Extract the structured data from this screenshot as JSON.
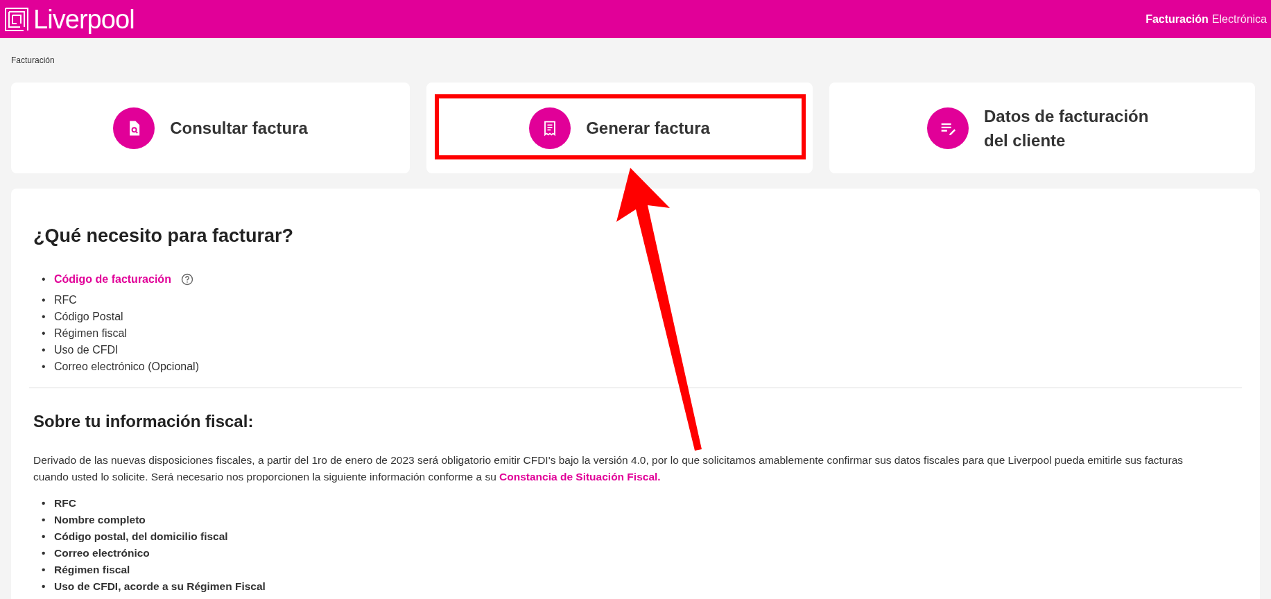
{
  "header": {
    "logo": "Liverpool",
    "title_bold": "Facturación",
    "title_light": "Electrónica"
  },
  "breadcrumb": "Facturación",
  "cards": [
    {
      "label": "Consultar factura",
      "highlighted": false
    },
    {
      "label": "Generar factura",
      "highlighted": true
    },
    {
      "label": "Datos de facturación del cliente",
      "highlighted": false
    }
  ],
  "requirements": {
    "title": "¿Qué necesito para facturar?",
    "items": [
      {
        "bullet": "•",
        "text": "Código de facturación",
        "kind": "link"
      },
      {
        "bullet": "•",
        "text": "RFC",
        "kind": "plain"
      },
      {
        "bullet": "•",
        "text": "Código Postal",
        "kind": "plain"
      },
      {
        "bullet": "•",
        "text": "Régimen fiscal",
        "kind": "plain"
      },
      {
        "bullet": "•",
        "text": "Uso de CFDI",
        "kind": "plain"
      },
      {
        "bullet": "•",
        "text": "Correo electrónico (Opcional)",
        "kind": "plain"
      }
    ]
  },
  "fiscal": {
    "title": "Sobre tu información fiscal:",
    "paragraph": "Derivado de las nuevas disposiciones fiscales, a partir del 1ro de enero de 2023 será obligatorio emitir CFDI's bajo la versión 4.0, por lo que solicitamos amablemente confirmar sus datos fiscales para que Liverpool pueda emitirle sus facturas cuando usted lo solicite. Será necesario nos proporcionen la siguiente información conforme a su",
    "link": "Constancia de Situación Fiscal.",
    "items": [
      {
        "bullet": "•",
        "text": "RFC"
      },
      {
        "bullet": "•",
        "text": "Nombre completo"
      },
      {
        "bullet": "•",
        "text": "Código postal, del domicilio fiscal"
      },
      {
        "bullet": "•",
        "text": "Correo electrónico"
      },
      {
        "bullet": "•",
        "text": "Régimen fiscal"
      },
      {
        "bullet": "•",
        "text": "Uso de CFDI, acorde a su Régimen Fiscal"
      }
    ]
  },
  "arrow": true
}
